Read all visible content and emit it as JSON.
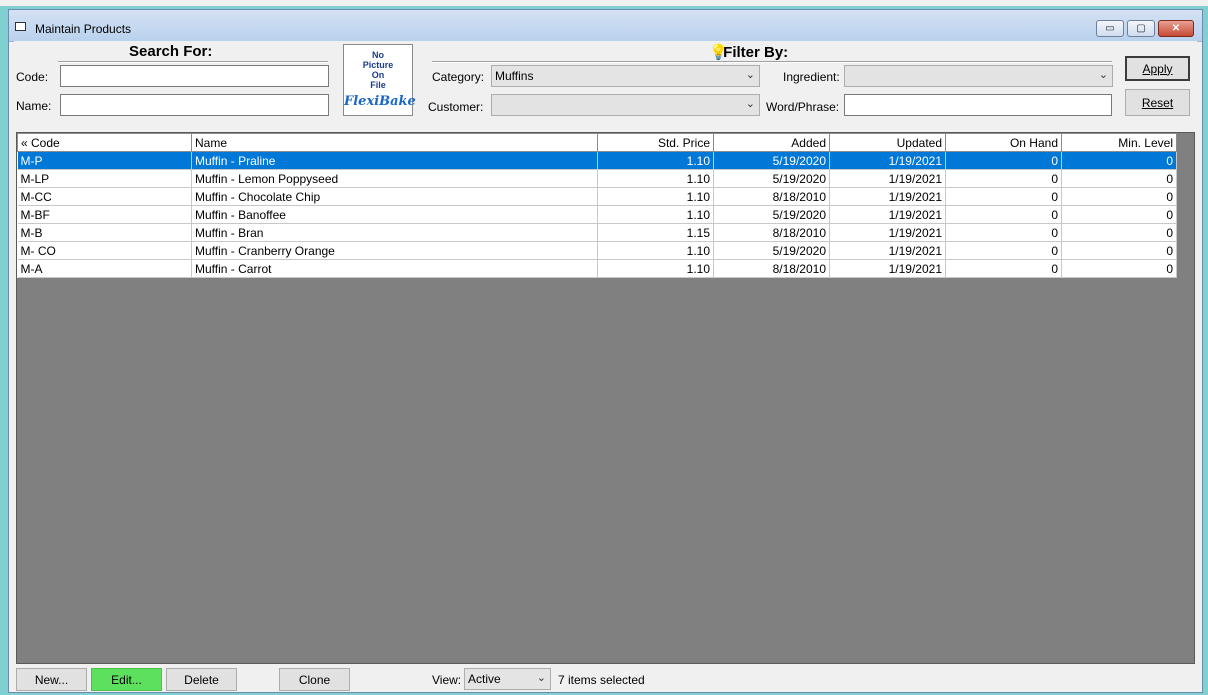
{
  "window": {
    "title": "Maintain Products",
    "controls": {
      "minimize": "▭",
      "restore": "▢",
      "close": "✕"
    }
  },
  "search": {
    "heading": "Search For:",
    "code_label": "Code:",
    "code_value": "",
    "name_label": "Name:",
    "name_value": ""
  },
  "picture": {
    "line1": "No",
    "line2": "Picture",
    "line3": "On",
    "line4": "File",
    "logo": "FlexiBake"
  },
  "filter": {
    "heading": "Filter By:",
    "category_label": "Category:",
    "category_value": "Muffins",
    "ingredient_label": "Ingredient:",
    "ingredient_value": "",
    "customer_label": "Customer:",
    "customer_value": "",
    "word_label": "Word/Phrase:",
    "word_value": ""
  },
  "actions": {
    "apply": "Apply",
    "reset": "Reset"
  },
  "table": {
    "columns": [
      "« Code",
      "Name",
      "Std. Price",
      "Added",
      "Updated",
      "On Hand",
      "Min. Level"
    ],
    "rows": [
      {
        "code": "M-P",
        "name": "Muffin - Praline",
        "price": "1.10",
        "added": "5/19/2020",
        "updated": "1/19/2021",
        "onhand": "0",
        "min": "0",
        "selected": true
      },
      {
        "code": "M-LP",
        "name": "Muffin - Lemon Poppyseed",
        "price": "1.10",
        "added": "5/19/2020",
        "updated": "1/19/2021",
        "onhand": "0",
        "min": "0",
        "selected": false
      },
      {
        "code": "M-CC",
        "name": "Muffin - Chocolate Chip",
        "price": "1.10",
        "added": "8/18/2010",
        "updated": "1/19/2021",
        "onhand": "0",
        "min": "0",
        "selected": false
      },
      {
        "code": "M-BF",
        "name": "Muffin - Banoffee",
        "price": "1.10",
        "added": "5/19/2020",
        "updated": "1/19/2021",
        "onhand": "0",
        "min": "0",
        "selected": false
      },
      {
        "code": "M-B",
        "name": "Muffin - Bran",
        "price": "1.15",
        "added": "8/18/2010",
        "updated": "1/19/2021",
        "onhand": "0",
        "min": "0",
        "selected": false
      },
      {
        "code": "M- CO",
        "name": "Muffin - Cranberry Orange",
        "price": "1.10",
        "added": "5/19/2020",
        "updated": "1/19/2021",
        "onhand": "0",
        "min": "0",
        "selected": false
      },
      {
        "code": "M-A",
        "name": "Muffin - Carrot",
        "price": "1.10",
        "added": "8/18/2010",
        "updated": "1/19/2021",
        "onhand": "0",
        "min": "0",
        "selected": false
      }
    ]
  },
  "bottom": {
    "new": "New...",
    "edit": "Edit...",
    "delete": "Delete",
    "clone": "Clone",
    "view_label": "View:",
    "view_value": "Active",
    "status": "7 items selected"
  },
  "colors": {
    "selection": "#0078d7",
    "edit_button": "#5de05d",
    "grid_background": "#808080"
  }
}
